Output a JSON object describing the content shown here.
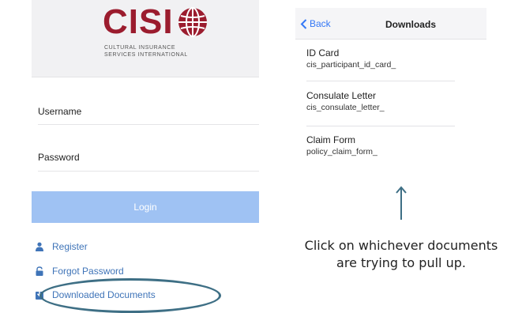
{
  "login_screen": {
    "logo_text": "CISI",
    "logo_subtitle_1": "CULTURAL INSURANCE",
    "logo_subtitle_2": "SERVICES INTERNATIONAL",
    "username_label": "Username",
    "password_label": "Password",
    "login_button": "Login",
    "menu": [
      {
        "label": "Register",
        "icon": "person-icon"
      },
      {
        "label": "Forgot Password",
        "icon": "lock-icon"
      },
      {
        "label": "Downloaded Documents",
        "icon": "download-icon"
      }
    ]
  },
  "downloads_screen": {
    "back_label": "Back",
    "title": "Downloads",
    "items": [
      {
        "title": "ID Card",
        "file": "cis_participant_id_card_"
      },
      {
        "title": "Consulate Letter",
        "file": "cis_consulate_letter_"
      },
      {
        "title": "Claim Form",
        "file": "policy_claim_form_"
      }
    ]
  },
  "instruction": "Click on whichever documents are trying to pull up.",
  "colors": {
    "brand": "#9b1c2e",
    "link": "#3f74b8",
    "ios_blue": "#3478f6",
    "login_button": "#9fc2f3",
    "highlight_ring": "#3e6f85"
  }
}
